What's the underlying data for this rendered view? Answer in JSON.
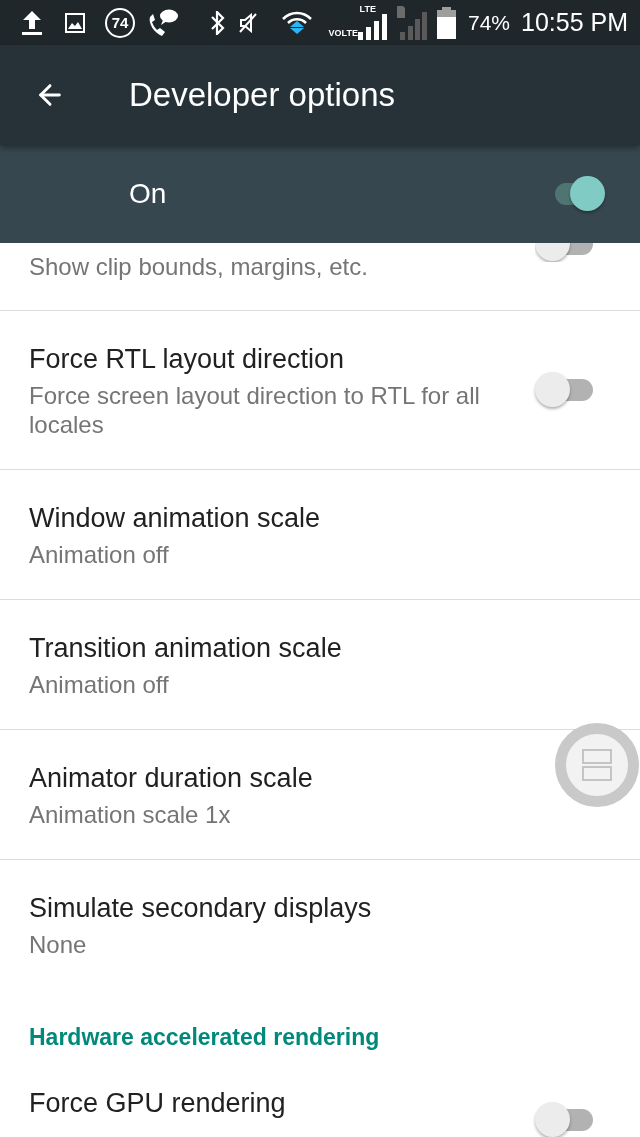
{
  "status_bar": {
    "badge_number": "74",
    "network_top": "LTE",
    "network_bottom": "VOLTE",
    "battery": "74%",
    "time": "10:55 PM"
  },
  "app_bar": {
    "title": "Developer options"
  },
  "master_switch": {
    "label": "On",
    "checked": true
  },
  "clipped_item": {
    "summary": "Show clip bounds, margins, etc.",
    "checked": false
  },
  "settings": [
    {
      "kind": "switch",
      "title": "Force RTL layout direction",
      "summary": "Force screen layout direction to RTL for all locales",
      "checked": false
    },
    {
      "kind": "value",
      "title": "Window animation scale",
      "summary": "Animation off"
    },
    {
      "kind": "value",
      "title": "Transition animation scale",
      "summary": "Animation off"
    },
    {
      "kind": "value",
      "title": "Animator duration scale",
      "summary": "Animation scale 1x"
    },
    {
      "kind": "value",
      "title": "Simulate secondary displays",
      "summary": "None"
    },
    {
      "kind": "header",
      "title": "Hardware accelerated rendering"
    },
    {
      "kind": "switch",
      "title": "Force GPU rendering",
      "checked": false
    }
  ]
}
